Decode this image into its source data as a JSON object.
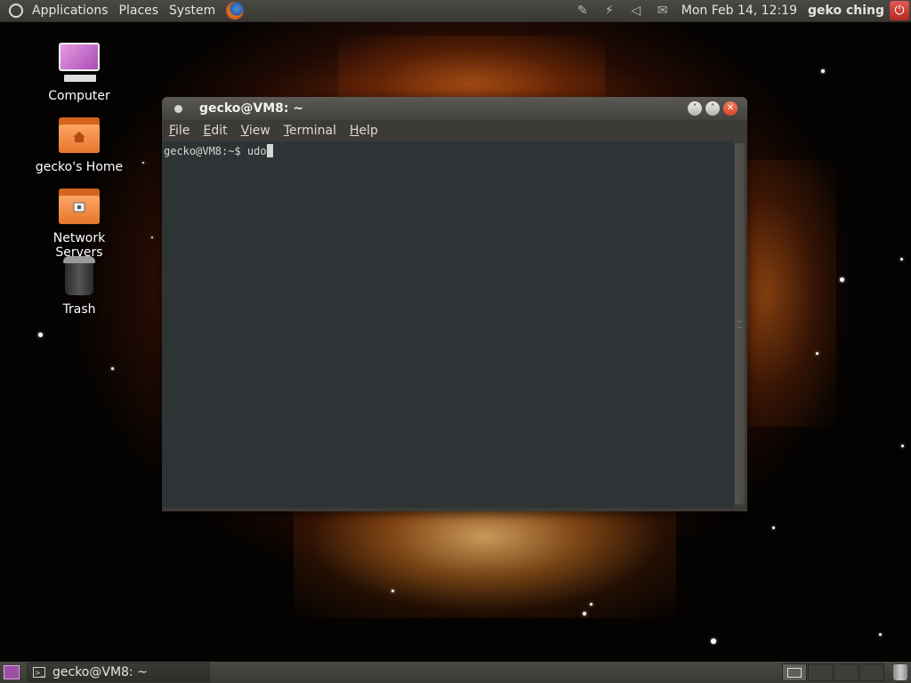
{
  "top_panel": {
    "menus": [
      "Applications",
      "Places",
      "System"
    ],
    "clock": "Mon Feb 14, 12:19",
    "user": "geko ching"
  },
  "desktop_icons": [
    {
      "label": "Computer",
      "icon": "computer-icon"
    },
    {
      "label": "gecko's Home",
      "icon": "home-folder-icon"
    },
    {
      "label": "Network Servers",
      "icon": "network-folder-icon"
    },
    {
      "label": "Trash",
      "icon": "trash-icon"
    }
  ],
  "terminal": {
    "title": "gecko@VM8: ~",
    "menu": {
      "file": {
        "key": "F",
        "rest": "ile"
      },
      "edit": {
        "key": "E",
        "rest": "dit"
      },
      "view": {
        "key": "V",
        "rest": "iew"
      },
      "terminal": {
        "key": "T",
        "rest": "erminal"
      },
      "help": {
        "key": "H",
        "rest": "elp"
      }
    },
    "prompt": "gecko@VM8:~$ ",
    "input": "udo"
  },
  "bottom_panel": {
    "task": "gecko@VM8: ~",
    "workspaces": 4,
    "active_workspace": 1
  },
  "colors": {
    "panel": "#3c3b37",
    "terminal_bg": "#2e3436",
    "terminal_fg": "#d3d7cf",
    "close_button": "#e0522f"
  }
}
